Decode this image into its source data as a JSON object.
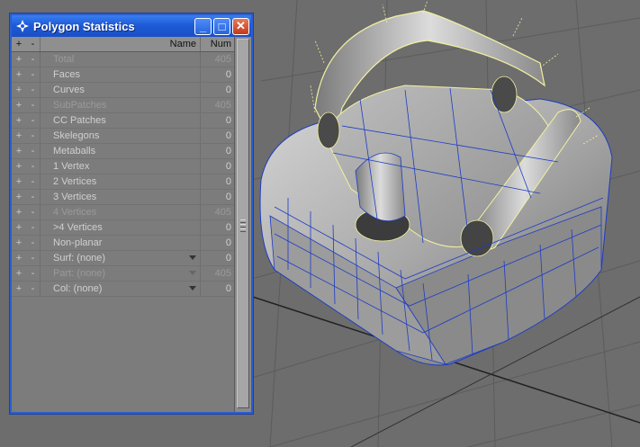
{
  "window": {
    "title": "Polygon Statistics",
    "minimize_label": "_",
    "maximize_label": "□",
    "close_label": "✕"
  },
  "header": {
    "plus": "+",
    "minus": "-",
    "name": "Name",
    "num": "Num"
  },
  "rows": [
    {
      "plus": "+",
      "minus": "-",
      "name": "Total",
      "num": "405",
      "dim": true
    },
    {
      "plus": "+",
      "minus": "-",
      "name": "Faces",
      "num": "0",
      "dim": false
    },
    {
      "plus": "+",
      "minus": "-",
      "name": "Curves",
      "num": "0",
      "dim": false
    },
    {
      "plus": "+",
      "minus": "-",
      "name": "SubPatches",
      "num": "405",
      "dim": true
    },
    {
      "plus": "+",
      "minus": "-",
      "name": "CC Patches",
      "num": "0",
      "dim": false
    },
    {
      "plus": "+",
      "minus": "-",
      "name": "Skelegons",
      "num": "0",
      "dim": false
    },
    {
      "plus": "+",
      "minus": "-",
      "name": "Metaballs",
      "num": "0",
      "dim": false
    },
    {
      "plus": "+",
      "minus": "-",
      "name": "1 Vertex",
      "num": "0",
      "dim": false
    },
    {
      "plus": "+",
      "minus": "-",
      "name": "2 Vertices",
      "num": "0",
      "dim": false
    },
    {
      "plus": "+",
      "minus": "-",
      "name": "3 Vertices",
      "num": "0",
      "dim": false
    },
    {
      "plus": "+",
      "minus": "-",
      "name": "4 Vertices",
      "num": "405",
      "dim": true
    },
    {
      "plus": "+",
      "minus": "-",
      "name": ">4 Vertices",
      "num": "0",
      "dim": false
    },
    {
      "plus": "+",
      "minus": "-",
      "name": "Non-planar",
      "num": "0",
      "dim": false
    },
    {
      "plus": "+",
      "minus": "-",
      "name": "Surf: (none)",
      "num": "0",
      "dim": false,
      "dropdown": true
    },
    {
      "plus": "+",
      "minus": "-",
      "name": "Part: (none)",
      "num": "405",
      "dim": true,
      "dropdown": true
    },
    {
      "plus": "+",
      "minus": "-",
      "name": "Col: (none)",
      "num": "0",
      "dim": false,
      "dropdown": true
    }
  ],
  "colors": {
    "titlebar": "#1e5bd8",
    "viewport_bg": "#6d6d6d",
    "grid": "#5f5f5f",
    "mesh_wire": "#1d3cc4",
    "edge_highlight": "#f2f0a0"
  }
}
